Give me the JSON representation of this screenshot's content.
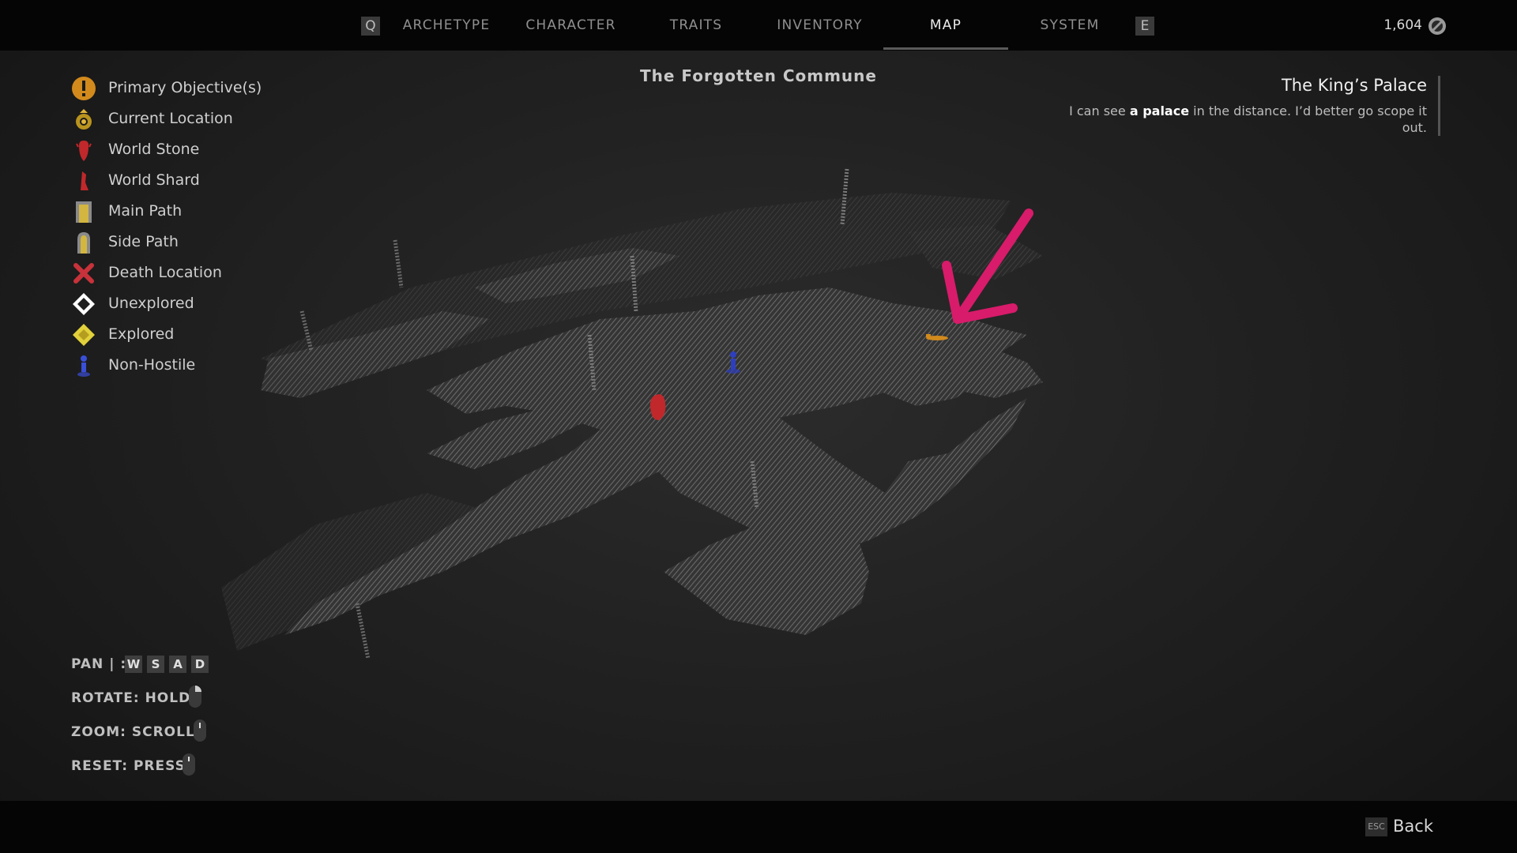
{
  "nav": {
    "left_key": "Q",
    "right_key": "E",
    "tabs": [
      "ARCHETYPE",
      "CHARACTER",
      "TRAITS",
      "INVENTORY",
      "MAP",
      "SYSTEM"
    ],
    "active_tab": "MAP",
    "currency": "1,604"
  },
  "legend": [
    {
      "icon": "primary-objective-icon",
      "label": "Primary Objective(s)"
    },
    {
      "icon": "current-location-icon",
      "label": "Current Location"
    },
    {
      "icon": "world-stone-icon",
      "label": "World Stone"
    },
    {
      "icon": "world-shard-icon",
      "label": "World Shard"
    },
    {
      "icon": "main-path-icon",
      "label": "Main Path"
    },
    {
      "icon": "side-path-icon",
      "label": "Side Path"
    },
    {
      "icon": "death-location-icon",
      "label": "Death Location"
    },
    {
      "icon": "unexplored-icon",
      "label": "Unexplored"
    },
    {
      "icon": "explored-icon",
      "label": "Explored"
    },
    {
      "icon": "non-hostile-icon",
      "label": "Non-Hostile"
    }
  ],
  "map": {
    "title": "The Forgotten Commune"
  },
  "location": {
    "name": "The King’s Palace",
    "desc_prefix": "I can see ",
    "desc_bold": "a palace",
    "desc_suffix": " in the distance. I’d better go scope it out."
  },
  "controls": {
    "pan_label": "PAN | :",
    "pan_keys": [
      "W",
      "S",
      "A",
      "D"
    ],
    "rotate_label": "ROTATE: HOLD",
    "zoom_label": "ZOOM: SCROLL",
    "reset_label": "RESET: PRESS"
  },
  "footer": {
    "esc_key": "ESC",
    "back_label": "Back"
  },
  "colors": {
    "annotation_arrow": "#d81b6a",
    "world_stone": "#c0282b",
    "npc": "#2d3fbf",
    "objective": "#d28a1c"
  }
}
